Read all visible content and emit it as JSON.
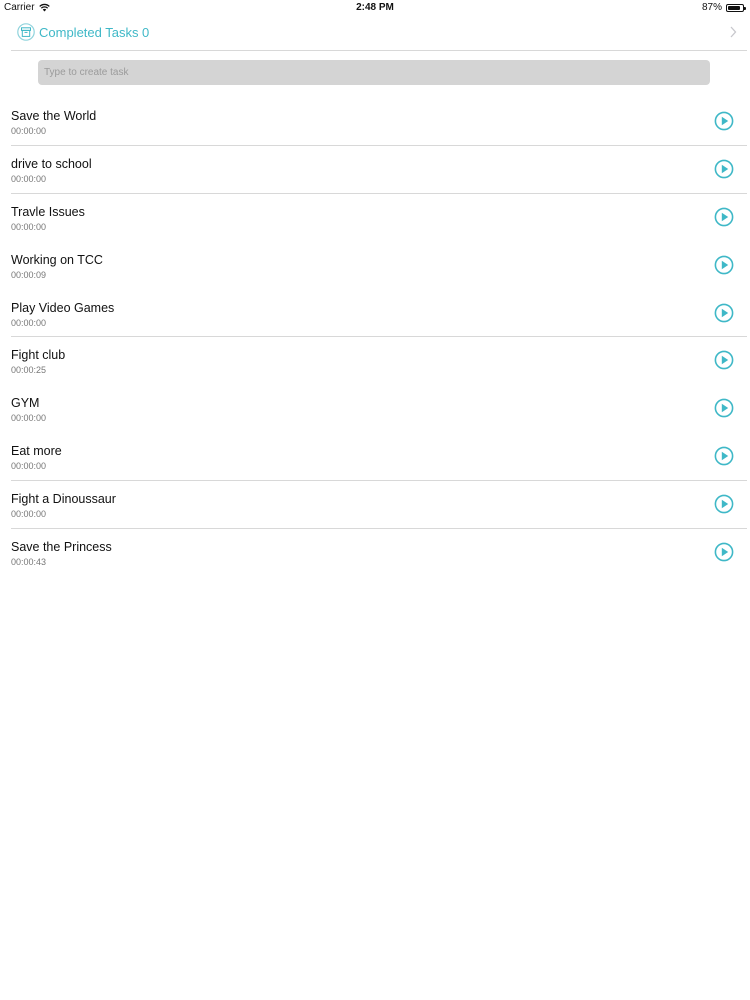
{
  "status_bar": {
    "carrier": "Carrier",
    "time": "2:48 PM",
    "battery": "87%",
    "battery_level": 0.87
  },
  "header": {
    "completed_label": "Completed Tasks",
    "completed_count": "0",
    "accent_color": "#3fb8c7"
  },
  "search": {
    "placeholder": "Type to create task",
    "value": ""
  },
  "tasks": [
    {
      "title": "Save the World",
      "time": "00:00:00",
      "divider": true
    },
    {
      "title": "drive to school",
      "time": "00:00:00",
      "divider": true
    },
    {
      "title": "Travle Issues",
      "time": "00:00:00",
      "divider": false
    },
    {
      "title": "Working on TCC",
      "time": "00:00:09",
      "divider": false
    },
    {
      "title": "Play Video Games",
      "time": "00:00:00",
      "divider": true
    },
    {
      "title": "Fight club",
      "time": "00:00:25",
      "divider": false
    },
    {
      "title": "GYM",
      "time": "00:00:00",
      "divider": false
    },
    {
      "title": "Eat more",
      "time": "00:00:00",
      "divider": true
    },
    {
      "title": "Fight a Dinoussaur",
      "time": "00:00:00",
      "divider": true
    },
    {
      "title": "Save the Princess",
      "time": "00:00:43",
      "divider": false
    }
  ]
}
